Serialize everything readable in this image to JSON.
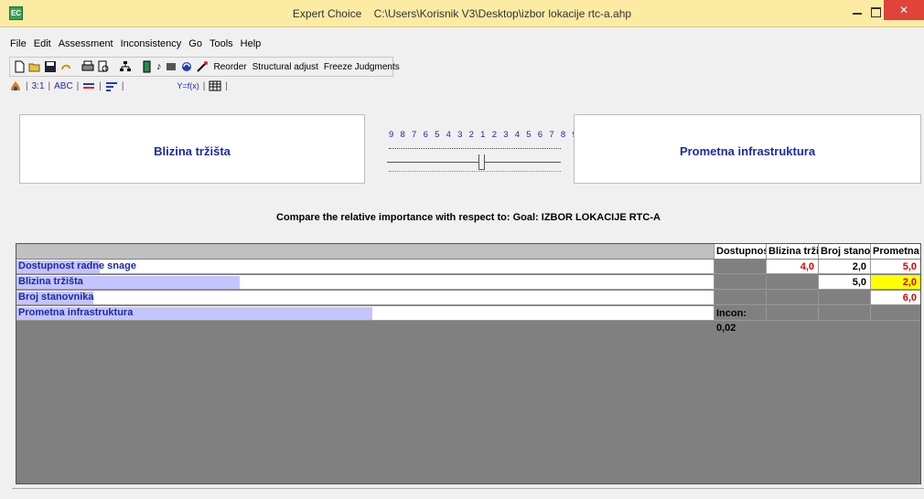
{
  "window": {
    "app_name": "Expert Choice",
    "file_path": "C:\\Users\\Korisnik V3\\Desktop\\izbor lokacije rtc-a.ahp",
    "minimize": "",
    "maximize": "",
    "close": "✕"
  },
  "menu": {
    "items": [
      "File",
      "Edit",
      "Assessment",
      "Inconsistency",
      "Go",
      "Tools",
      "Help"
    ]
  },
  "toolbar": {
    "reorder": "Reorder",
    "structural_adjust": "Structural adjust",
    "freeze_judgments": "Freeze Judgments"
  },
  "toolbar2": {
    "ratio": "3:1",
    "abc": "ABC",
    "formula": "Y=f(x)"
  },
  "compare": {
    "left": "Blizina tržišta",
    "right": "Prometna infrastruktura",
    "scale": "9 8 7 6 5 4 3 2 1 2 3 4 5 6 7 8 9",
    "slider_position": 1,
    "slider_side": "left"
  },
  "question": "Compare the relative importance  with respect to: Goal: IZBOR LOKACIJE RTC-A",
  "matrix": {
    "columns": [
      "Dostupnos",
      "Blizina trži",
      "Broj stanov",
      "Prometna i"
    ],
    "rows": [
      {
        "label": "Dostupnost radne snage",
        "bar_fraction": 0.12
      },
      {
        "label": "Blizina tržišta",
        "bar_fraction": 0.32
      },
      {
        "label": "Broj stanovnika",
        "bar_fraction": 0.11
      },
      {
        "label": "Prometna infrastruktura",
        "bar_fraction": 0.51
      }
    ],
    "cells": {
      "r0c1": "4,0",
      "r0c2": "2,0",
      "r0c3": "5,0",
      "r1c2": "5,0",
      "r1c3": "2,0",
      "r2c3": "6,0",
      "r3c0": "Incon: 0,02"
    },
    "colors": {
      "red": "#e00000",
      "highlight": "#ffff00",
      "bar": "#c4c4ff"
    }
  }
}
